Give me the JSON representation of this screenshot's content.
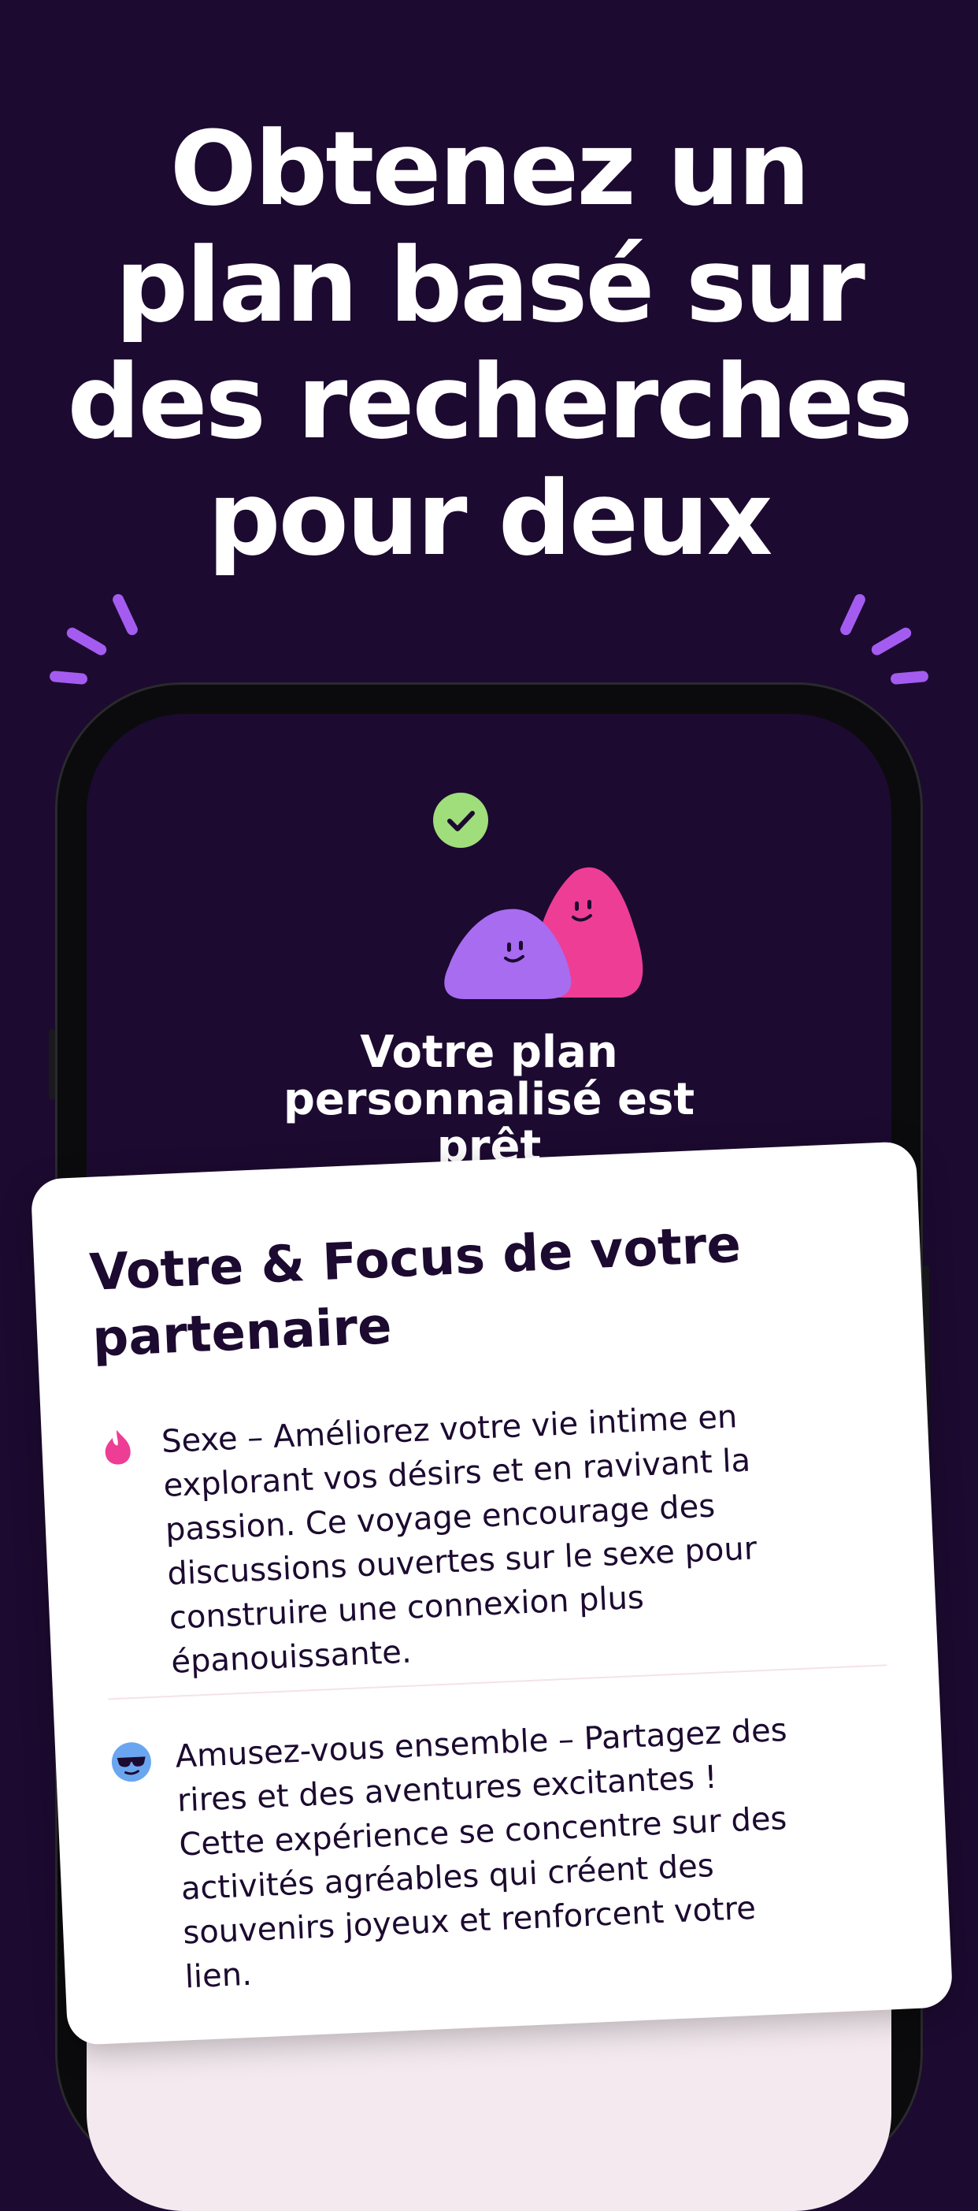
{
  "headline": {
    "lines": [
      "Obtenez un",
      "plan basé sur",
      "des recherches",
      "pour deux"
    ]
  },
  "phone_screen": {
    "title_lines": [
      "Votre plan",
      "personnalisé est",
      "prêt"
    ],
    "checkmark_icon": "check-circle-icon",
    "mascot": "two-blob-mascots"
  },
  "card": {
    "title_lines": [
      "Votre & Focus de votre",
      "partenaire"
    ],
    "items": [
      {
        "icon": "flame-icon",
        "icon_color": "#ee3d95",
        "lines": [
          "Sexe – Améliorez votre vie intime en",
          "explorant vos désirs et en ravivant la",
          "passion. Ce voyage encourage des",
          "discussions ouvertes sur le sexe pour",
          "construire une connexion plus",
          "épanouissante."
        ]
      },
      {
        "icon": "sunglasses-face-icon",
        "icon_color": "#6aa6f0",
        "lines": [
          "Amusez-vous ensemble – Partagez des",
          "rires et des aventures excitantes !",
          "Cette expérience se concentre sur des",
          "activités agréables qui créent des",
          "souvenirs joyeux et renforcent votre",
          "lien."
        ]
      }
    ]
  },
  "colors": {
    "background": "#1c0a30",
    "accent_purple": "#a45cf0",
    "accent_pink": "#ee3d95",
    "check_green": "#9fde7a"
  }
}
